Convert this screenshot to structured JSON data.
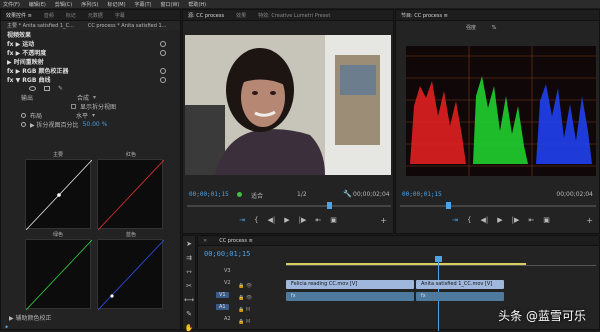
{
  "menu": [
    "文件(F)",
    "编辑(E)",
    "剪辑(C)",
    "序列(S)",
    "标记(M)",
    "字幕(T)",
    "窗口(W)",
    "帮助(H)"
  ],
  "effect_controls": {
    "tabs": [
      "效果控件 ≡",
      "音频",
      "标记",
      "元数据",
      "字幕"
    ],
    "source_label": "主要 * Anita satisfied 1_C...",
    "sequence_label": "CC process * Anita satisfied 1...",
    "video_effects": "视频效果",
    "items": [
      "fx ▶ 运动",
      "fx ▶ 不透明度",
      "▶ 时间重映射",
      "fx ▶ RGB 颜色校正器"
    ],
    "rgb_curves": "fx ▼ RGB 曲线",
    "output_label": "输出",
    "output_value": "合成",
    "split_label": "显示拆分视图",
    "layout_label": "布局",
    "layout_value": "水平",
    "split_percent_label": "▶ 拆分视图百分比",
    "split_percent_value": "50.00 %",
    "curve_labels": [
      "主要",
      "红色",
      "绿色",
      "蓝色"
    ],
    "bottom_label": "▶ 辅助颜色校正"
  },
  "program_monitor": {
    "tabs": [
      "源: CC process",
      "效果",
      "特效: Creative Lumetri Preset"
    ],
    "timecode_in": "00;00;01;15",
    "fit": "适合",
    "quality": "1/2",
    "timecode_out": "00;00;02;04"
  },
  "scopes": {
    "title": "节目: CC process ≡",
    "header": "强度",
    "percent": "%",
    "timecode": "00;00;01;15",
    "timecode_right": "00;00;02;04",
    "colors": {
      "red": "#e02020",
      "green": "#20d030",
      "blue": "#2040f0"
    }
  },
  "timeline": {
    "tab": "CC process ≡",
    "timecode": "00;00;01;15",
    "tracks": [
      "V3",
      "V2",
      "V1",
      "A1",
      "A2"
    ],
    "clip1": "Felicia reading CC.mov [V]",
    "clip2": "Anita satisfied 1_CC.mov [V]",
    "clip1_fx": "fx",
    "clip2_fx": "fx"
  },
  "watermark": "头条 @蓝雪可乐"
}
